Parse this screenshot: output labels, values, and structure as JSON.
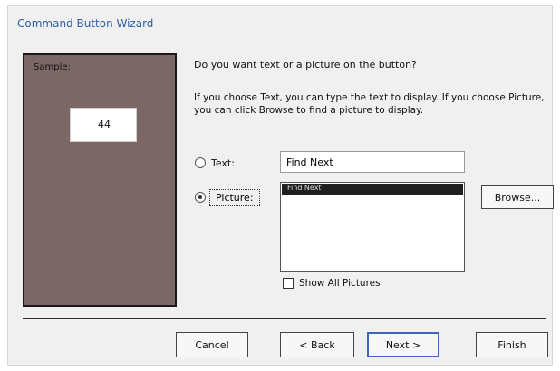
{
  "window": {
    "title": "Command Button Wizard"
  },
  "sample": {
    "label": "Sample:",
    "button_text": "44"
  },
  "question": "Do you want text or a picture on the button?",
  "help_text": "If you choose Text, you can type the text to display. If you choose Picture, you can click Browse to find a picture to display.",
  "options": {
    "text_label": "Text:",
    "picture_label": "Picture:",
    "selected": "picture"
  },
  "text_field": {
    "value": "Find Next"
  },
  "picture_list": {
    "selected_item": "Find Next"
  },
  "browse_button": "Browse...",
  "show_all_pictures": {
    "label": "Show All Pictures",
    "checked": false
  },
  "buttons": {
    "cancel": "Cancel",
    "back": "< Back",
    "next": "Next >",
    "finish": "Finish"
  }
}
